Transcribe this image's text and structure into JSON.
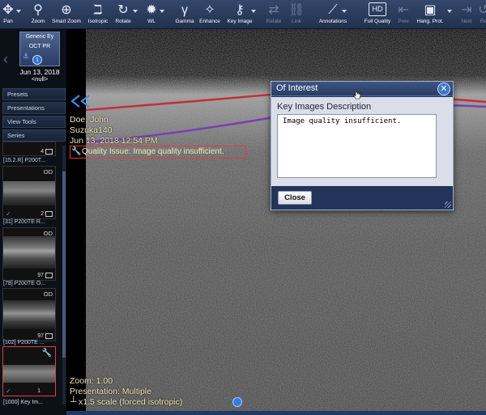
{
  "toolbar": {
    "tools": [
      {
        "label": "Pan",
        "icon": "pan-icon",
        "enabled": true,
        "dropdown": true
      },
      {
        "label": "Zoom",
        "icon": "zoom-icon",
        "enabled": true,
        "dropdown": false
      },
      {
        "label": "Smart Zoom",
        "icon": "smart-zoom-icon",
        "enabled": true,
        "dropdown": false
      },
      {
        "label": "Isotropic",
        "icon": "isotropic-icon",
        "enabled": true,
        "dropdown": false
      },
      {
        "label": "Rotate",
        "icon": "rotate-icon",
        "enabled": true,
        "dropdown": true
      },
      {
        "label": "WL",
        "icon": "window-level-icon",
        "enabled": true,
        "dropdown": true
      },
      {
        "label": "Gamma",
        "icon": "gamma-icon",
        "enabled": true,
        "dropdown": false
      },
      {
        "label": "Enhance",
        "icon": "enhance-icon",
        "enabled": true,
        "dropdown": false
      },
      {
        "label": "Key Image",
        "icon": "key-image-icon",
        "enabled": true,
        "dropdown": true
      },
      {
        "label": "Relate",
        "icon": "relate-icon",
        "enabled": false,
        "dropdown": false
      },
      {
        "label": "Link",
        "icon": "link-icon",
        "enabled": false,
        "dropdown": false
      },
      {
        "label": "Annotations",
        "icon": "annotations-icon",
        "enabled": true,
        "dropdown": true
      },
      {
        "label": "Full Quality",
        "icon": "hd-icon",
        "enabled": true,
        "dropdown": false
      },
      {
        "label": "Prev",
        "icon": "prev-icon",
        "enabled": false,
        "dropdown": false
      },
      {
        "label": "Hang. Prot.",
        "icon": "hanging-protocol-icon",
        "enabled": true,
        "dropdown": true
      },
      {
        "label": "Next",
        "icon": "next-icon",
        "enabled": false,
        "dropdown": false
      },
      {
        "label": "Re",
        "icon": "reset-icon",
        "enabled": false,
        "dropdown": false
      }
    ]
  },
  "study": {
    "card_line1": "Generic Ey",
    "card_line2": "OCT PR",
    "badge": "1",
    "date": "Jun 13, 2018",
    "null_text": "<null>"
  },
  "left_menu": [
    "Presets",
    "Presentations",
    "View Tools",
    "Series"
  ],
  "series": [
    {
      "eye": "",
      "count": "4",
      "label": "[15.2.R] P200T..."
    },
    {
      "eye": "OD",
      "count": "2",
      "label": "[31] P200TE R..."
    },
    {
      "eye": "OD",
      "count": "97",
      "label": "[78] P200TE O..."
    },
    {
      "eye": "OD",
      "count": "97",
      "label": "[102] P200TE ..."
    },
    {
      "eye": "",
      "count": "1",
      "label": "[1000] Key Im..."
    }
  ],
  "overlay": {
    "patient_name": "Doe, John",
    "study_name": "Suzuka140",
    "timestamp": "Jun 13, 2018 12:54 PM",
    "quality_issue": "Quality Issue: Image quality insufficient.",
    "zoom": "Zoom: 1.00",
    "presentation": "Presentation: Multiple",
    "scale": "x1.5 scale (forced isotropic)"
  },
  "dialog": {
    "title": "Of Interest",
    "close_glyph": "✕",
    "label": "Key Images Description",
    "text": "Image quality insufficient.",
    "close_button": "Close"
  },
  "colors": {
    "toolbar": "#2c3d5f",
    "segmentation_top": "#c0303a",
    "segmentation_mid": "#7a3fb0",
    "highlight": "#e53b3b",
    "overlay_text": "#f0e6b4"
  }
}
